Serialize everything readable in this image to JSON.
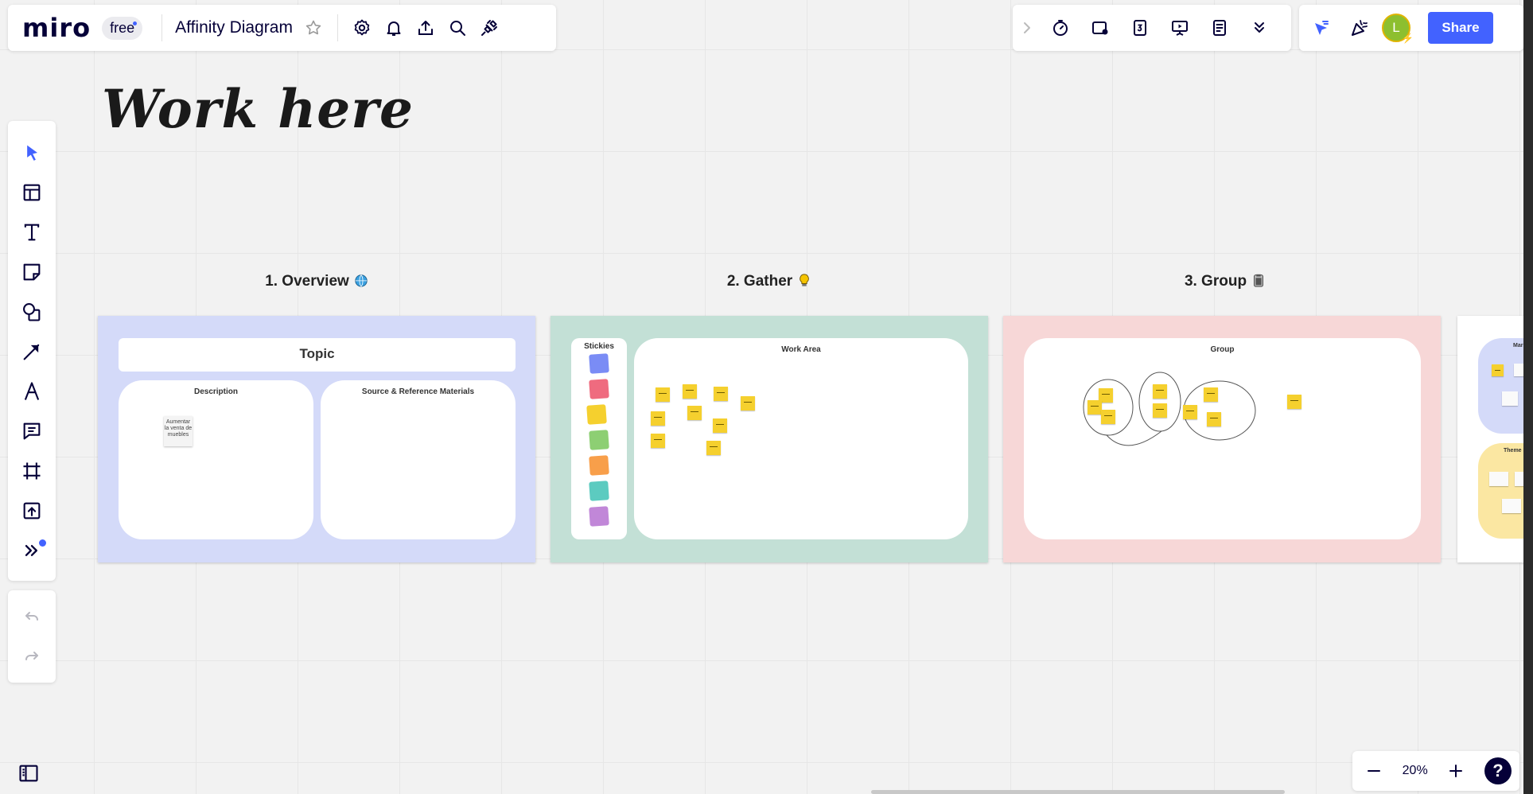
{
  "app": {
    "logo": "miro",
    "plan": "free"
  },
  "board": {
    "title": "Affinity Diagram"
  },
  "canvas": {
    "heading": "Work here",
    "sections": [
      {
        "title": "1. Overview"
      },
      {
        "title": "2. Gather"
      },
      {
        "title": "3. Group"
      }
    ]
  },
  "overview_frame": {
    "topic_label": "Topic",
    "description_label": "Description",
    "sources_label": "Source & Reference Materials",
    "sticky_text": "Aumentar la venta de muebles"
  },
  "gather_frame": {
    "stickies_label": "Stickies",
    "work_area_label": "Work Area",
    "palette_colors": [
      "#7a8cf5",
      "#ef6b7f",
      "#f5d02e",
      "#8dcf73",
      "#f89f4a",
      "#5ccbc0",
      "#c187d8"
    ]
  },
  "group_frame": {
    "group_label": "Group"
  },
  "next_frame": {
    "title_1": "Marke",
    "title_2": "Theme N"
  },
  "toolbar": {
    "share_label": "Share",
    "avatar_initial": "L"
  },
  "zoom": {
    "value": "20%"
  },
  "help": {
    "label": "?"
  },
  "colors": {
    "accent": "#4262ff",
    "overview_bg": "#d4daf9",
    "gather_bg": "#c3e0d6",
    "group_bg": "#f7d7d7",
    "sticky_yellow": "#f5d02e"
  }
}
